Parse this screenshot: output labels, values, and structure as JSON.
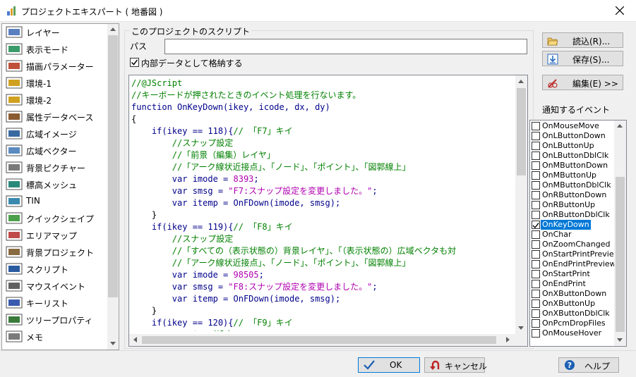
{
  "window": {
    "title": "プロジェクトエキスパート ( 地番図 )",
    "close_glyph": "✕"
  },
  "nav": {
    "items": [
      {
        "label": "レイヤー",
        "icon": "layer-icon"
      },
      {
        "label": "表示モード",
        "icon": "display-mode-icon"
      },
      {
        "label": "描画パラメーター",
        "icon": "draw-params-icon"
      },
      {
        "label": "環境-1",
        "icon": "env1-icon"
      },
      {
        "label": "環境-2",
        "icon": "env2-icon"
      },
      {
        "label": "属性データベース",
        "icon": "attribute-db-icon"
      },
      {
        "label": "広域イメージ",
        "icon": "wide-image-icon"
      },
      {
        "label": "広域ベクター",
        "icon": "wide-vector-icon"
      },
      {
        "label": "背景ピクチャー",
        "icon": "background-picture-icon"
      },
      {
        "label": "標高メッシュ",
        "icon": "elevation-mesh-icon"
      },
      {
        "label": "TIN",
        "icon": "tin-icon"
      },
      {
        "label": "クイックシェイプ",
        "icon": "quick-shape-icon"
      },
      {
        "label": "エリアマップ",
        "icon": "area-map-icon"
      },
      {
        "label": "背景プロジェクト",
        "icon": "background-project-icon"
      },
      {
        "label": "スクリプト",
        "icon": "script-icon",
        "selected": true
      },
      {
        "label": "マウスイベント",
        "icon": "mouse-icon"
      },
      {
        "label": "キーリスト",
        "icon": "key-list-icon"
      },
      {
        "label": "ツリープロパティ",
        "icon": "tree-property-icon"
      },
      {
        "label": "メモ",
        "icon": "memo-icon"
      }
    ]
  },
  "script": {
    "group_label": "このプロジェクトのスクリプト",
    "path_label": "パス",
    "path_value": "",
    "store_internal_label": "内部データとして格納する",
    "store_internal_checked": true,
    "code_lines": [
      [
        {
          "t": "//@JScript",
          "c": "green"
        }
      ],
      [
        {
          "t": "//キーボードが押されたときのイベント処理を行ないます。",
          "c": "green"
        }
      ],
      [
        {
          "t": "function",
          "c": "blue"
        },
        {
          "t": " OnKeyDown(ikey, icode, dx, dy)",
          "c": "blue"
        }
      ],
      [
        {
          "t": "{",
          "c": "black"
        }
      ],
      [
        {
          "t": "    if(ikey == 118){",
          "c": "blue"
        },
        {
          "t": "// 「F7」キイ",
          "c": "green"
        }
      ],
      [
        {
          "t": "        //スナップ設定",
          "c": "green"
        }
      ],
      [
        {
          "t": "        //「前景（編集）レイヤ」",
          "c": "green"
        }
      ],
      [
        {
          "t": "        //「アーク線状近接点」、「ノード」、「ポイント」、「図郭線上」",
          "c": "green"
        }
      ],
      [
        {
          "t": "        var imode = ",
          "c": "blue"
        },
        {
          "t": "8393",
          "c": "magenta"
        },
        {
          "t": ";",
          "c": "blue"
        }
      ],
      [
        {
          "t": "        var smsg = ",
          "c": "blue"
        },
        {
          "t": "\"F7:スナップ設定を変更しました。\"",
          "c": "magenta"
        },
        {
          "t": ";",
          "c": "blue"
        }
      ],
      [
        {
          "t": "        var itemp = OnFDown(imode, smsg);",
          "c": "blue"
        }
      ],
      [
        {
          "t": "    }",
          "c": "black"
        }
      ],
      [
        {
          "t": "    if(ikey == 119){",
          "c": "blue"
        },
        {
          "t": "// 「F8」キイ",
          "c": "green"
        }
      ],
      [
        {
          "t": "        //スナップ設定",
          "c": "green"
        }
      ],
      [
        {
          "t": "        //「すべての（表示状態の）背景レイヤ」、「（表示状態の）広域ベクタも対",
          "c": "green"
        }
      ],
      [
        {
          "t": "        //「アーク線状近接点」、「ノード」、「ポイント」、「図郭線上」",
          "c": "green"
        }
      ],
      [
        {
          "t": "        var imode = ",
          "c": "blue"
        },
        {
          "t": "98505",
          "c": "magenta"
        },
        {
          "t": ";",
          "c": "blue"
        }
      ],
      [
        {
          "t": "        var smsg = ",
          "c": "blue"
        },
        {
          "t": "\"F8:スナップ設定を変更しました。\"",
          "c": "magenta"
        },
        {
          "t": ";",
          "c": "blue"
        }
      ],
      [
        {
          "t": "        var itemp = OnFDown(imode, smsg);",
          "c": "blue"
        }
      ],
      [
        {
          "t": "    }",
          "c": "black"
        }
      ],
      [
        {
          "t": "    if(ikey == 120){",
          "c": "blue"
        },
        {
          "t": "// 「F9」キイ",
          "c": "green"
        }
      ],
      [
        {
          "t": "        //スナップ設定",
          "c": "green"
        }
      ]
    ]
  },
  "buttons": {
    "load": "読込(R)...",
    "save": "保存(S)...",
    "edit": "編集(E) >>",
    "ok": "OK",
    "cancel": "キャンセル",
    "help": "ヘルプ"
  },
  "events": {
    "label": "通知するイベント",
    "items": [
      {
        "label": "OnMouseMove",
        "checked": false
      },
      {
        "label": "OnLButtonDown",
        "checked": false
      },
      {
        "label": "OnLButtonUp",
        "checked": false
      },
      {
        "label": "OnLButtonDblClk",
        "checked": false
      },
      {
        "label": "OnMButtonDown",
        "checked": false
      },
      {
        "label": "OnMButtonUp",
        "checked": false
      },
      {
        "label": "OnMButtonDblClk",
        "checked": false
      },
      {
        "label": "OnRButtonDown",
        "checked": false
      },
      {
        "label": "OnRButtonUp",
        "checked": false
      },
      {
        "label": "OnRButtonDblClk",
        "checked": false
      },
      {
        "label": "OnKeyDown",
        "checked": true
      },
      {
        "label": "OnChar",
        "checked": false
      },
      {
        "label": "OnZoomChanged",
        "checked": false
      },
      {
        "label": "OnStartPrintPrevie",
        "checked": false
      },
      {
        "label": "OnEndPrintPreview",
        "checked": false
      },
      {
        "label": "OnStartPrint",
        "checked": false
      },
      {
        "label": "OnEndPrint",
        "checked": false
      },
      {
        "label": "OnXButtonDown",
        "checked": false
      },
      {
        "label": "OnXButtonUp",
        "checked": false
      },
      {
        "label": "OnXButtonDblClk",
        "checked": false
      },
      {
        "label": "OnPcmDropFiles",
        "checked": false
      },
      {
        "label": "OnMouseHover",
        "checked": false
      }
    ]
  },
  "colors": {
    "accent": "#0078d7",
    "code_comment": "#008000",
    "code_keyword": "#00008b",
    "code_string": "#b000b0"
  }
}
